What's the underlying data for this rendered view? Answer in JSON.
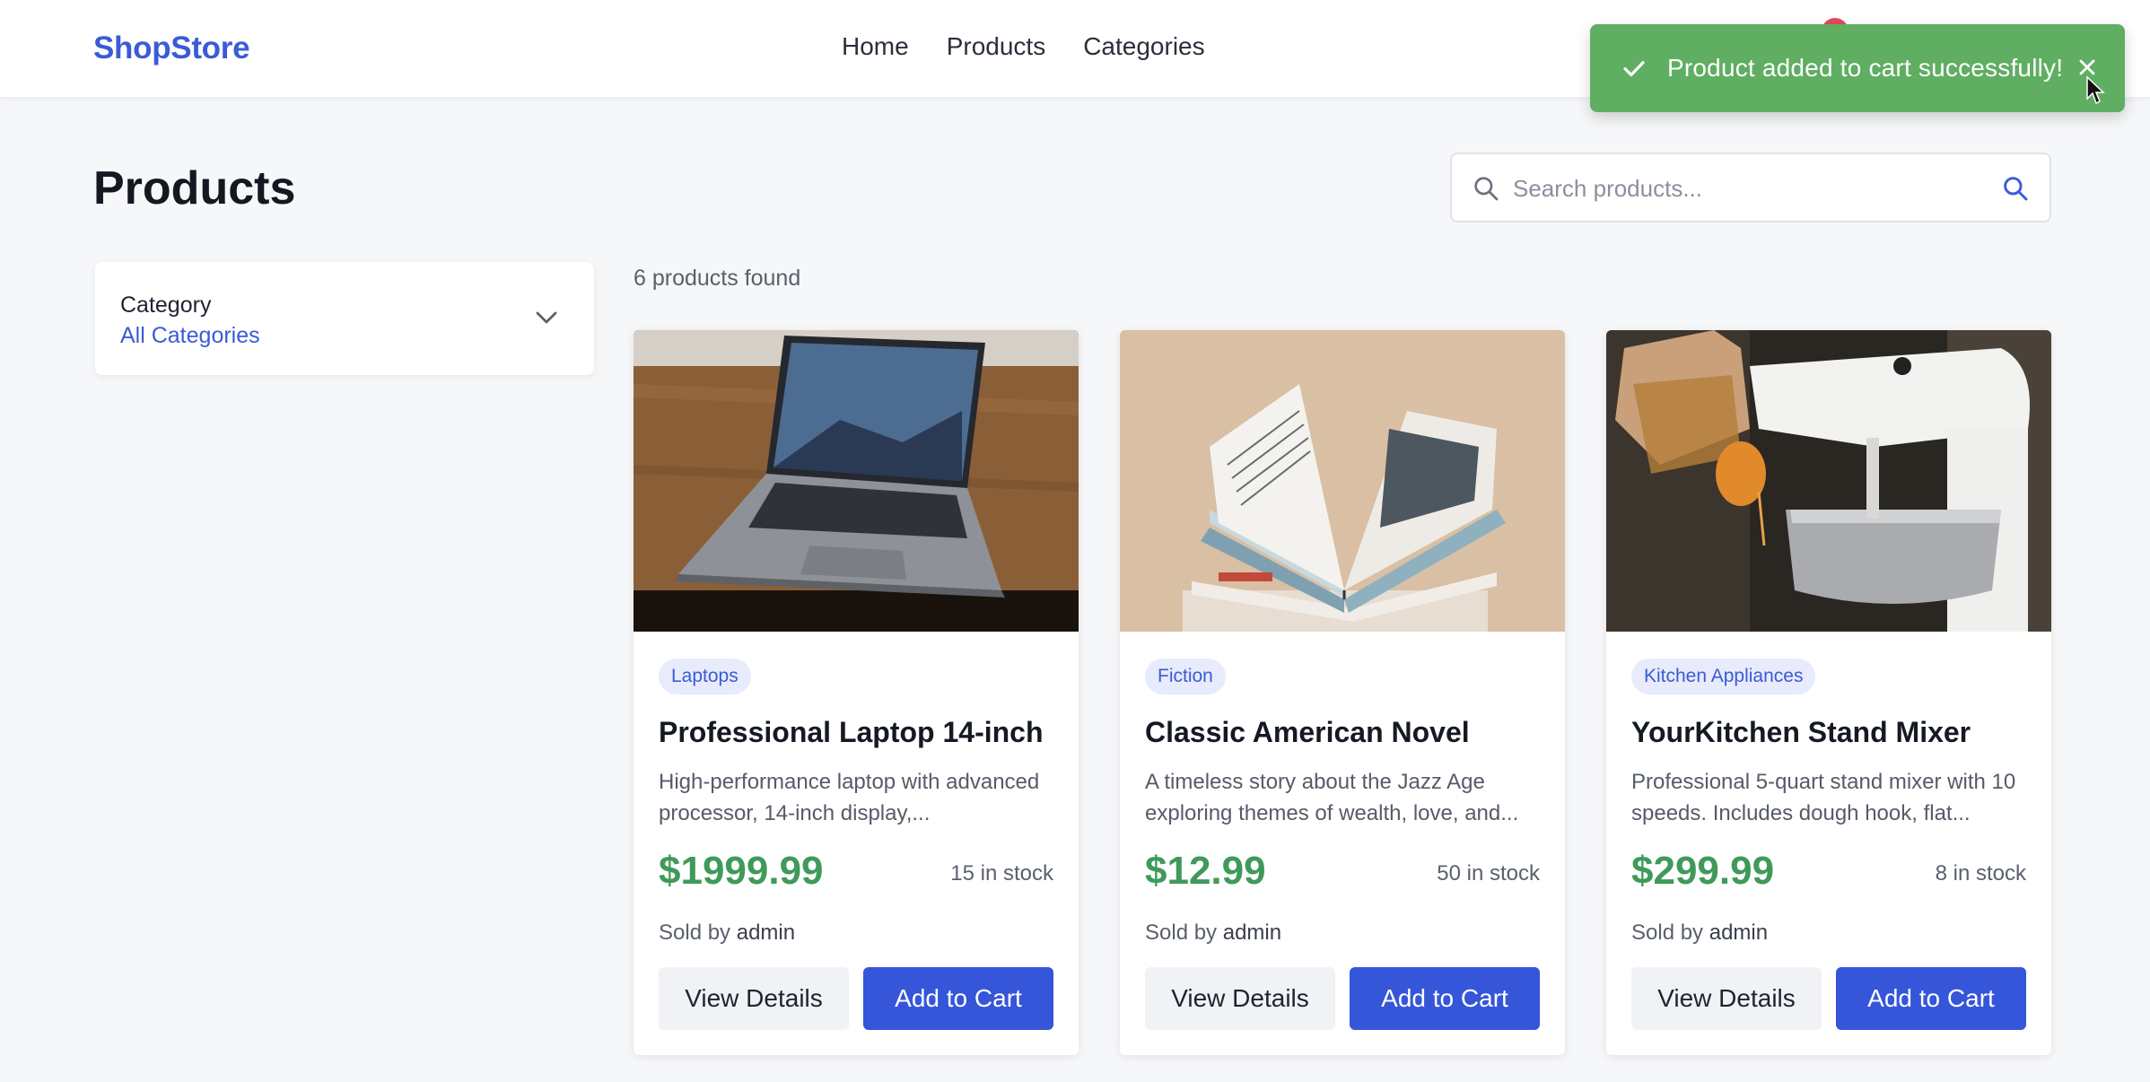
{
  "header": {
    "logo": "ShopStore",
    "nav": [
      "Home",
      "Products",
      "Categories"
    ]
  },
  "toast": {
    "message": "Product added to cart successfully!",
    "icon": "check-icon",
    "close_icon": "close-icon",
    "color": "#5fae62"
  },
  "page": {
    "title": "Products"
  },
  "search": {
    "placeholder": "Search products...",
    "value": ""
  },
  "filter": {
    "label": "Category",
    "value": "All Categories"
  },
  "results": {
    "count_text": "6 products found"
  },
  "products": [
    {
      "category": "Laptops",
      "name": "Professional Laptop 14-inch",
      "description": "High-performance laptop with advanced processor, 14-inch display,...",
      "price": "$1999.99",
      "stock": "15 in stock",
      "sold_by_prefix": "Sold by",
      "seller": "admin",
      "view_label": "View Details",
      "cart_label": "Add to Cart",
      "image": "laptop-photo"
    },
    {
      "category": "Fiction",
      "name": "Classic American Novel",
      "description": "A timeless story about the Jazz Age exploring themes of wealth, love, and...",
      "price": "$12.99",
      "stock": "50 in stock",
      "sold_by_prefix": "Sold by",
      "seller": "admin",
      "view_label": "View Details",
      "cart_label": "Add to Cart",
      "image": "book-photo"
    },
    {
      "category": "Kitchen Appliances",
      "name": "YourKitchen Stand Mixer",
      "description": "Professional 5-quart stand mixer with 10 speeds. Includes dough hook, flat...",
      "price": "$299.99",
      "stock": "8 in stock",
      "sold_by_prefix": "Sold by",
      "seller": "admin",
      "view_label": "View Details",
      "cart_label": "Add to Cart",
      "image": "mixer-photo"
    }
  ],
  "colors": {
    "brand": "#3b5bd6",
    "primary_button": "#3556d9",
    "price": "#3f9a5a",
    "toast": "#5fae62"
  }
}
